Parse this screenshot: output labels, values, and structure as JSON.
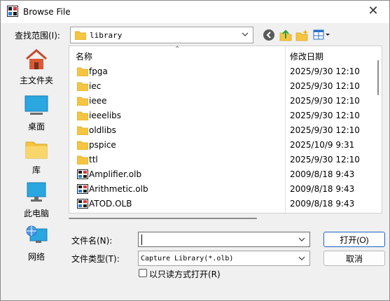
{
  "window": {
    "title": "Browse File",
    "close_glyph": "✕"
  },
  "toolbar": {
    "look_in_label": "查找范围(I):",
    "look_in_value": "library",
    "icons": [
      "back-icon",
      "up-folder-icon",
      "new-folder-icon",
      "view-menu-icon"
    ]
  },
  "places": [
    {
      "label": "主文件夹",
      "icon": "home-icon"
    },
    {
      "label": "桌面",
      "icon": "desktop-icon"
    },
    {
      "label": "库",
      "icon": "library-icon"
    },
    {
      "label": "此电脑",
      "icon": "computer-icon"
    },
    {
      "label": "网络",
      "icon": "network-icon"
    }
  ],
  "list": {
    "columns": {
      "name": "名称",
      "date": "修改日期"
    },
    "rows": [
      {
        "type": "folder",
        "name": "fpga",
        "date": "2025/9/30 12:10"
      },
      {
        "type": "folder",
        "name": "iec",
        "date": "2025/9/30 12:10"
      },
      {
        "type": "folder",
        "name": "ieee",
        "date": "2025/9/30 12:10"
      },
      {
        "type": "folder",
        "name": "ieeelibs",
        "date": "2025/9/30 12:10"
      },
      {
        "type": "folder",
        "name": "oldlibs",
        "date": "2025/9/30 12:10"
      },
      {
        "type": "folder",
        "name": "pspice",
        "date": "2025/10/9 9:31"
      },
      {
        "type": "folder",
        "name": "ttl",
        "date": "2025/9/30 12:10"
      },
      {
        "type": "olb",
        "name": "Amplifier.olb",
        "date": "2009/8/18 9:43"
      },
      {
        "type": "olb",
        "name": "Arithmetic.olb",
        "date": "2009/8/18 9:43"
      },
      {
        "type": "olb",
        "name": "ATOD.OLB",
        "date": "2009/8/18 9:43"
      }
    ]
  },
  "form": {
    "filename_label": "文件名(N):",
    "filename_value": "",
    "filetype_label": "文件类型(T):",
    "filetype_value": "Capture Library(*.olb)",
    "readonly_label": "以只读方式打开(R)",
    "open_button": "打开(O)",
    "cancel_button": "取消"
  },
  "colors": {
    "folder": "#f5c542",
    "accent": "#1f63c2"
  }
}
